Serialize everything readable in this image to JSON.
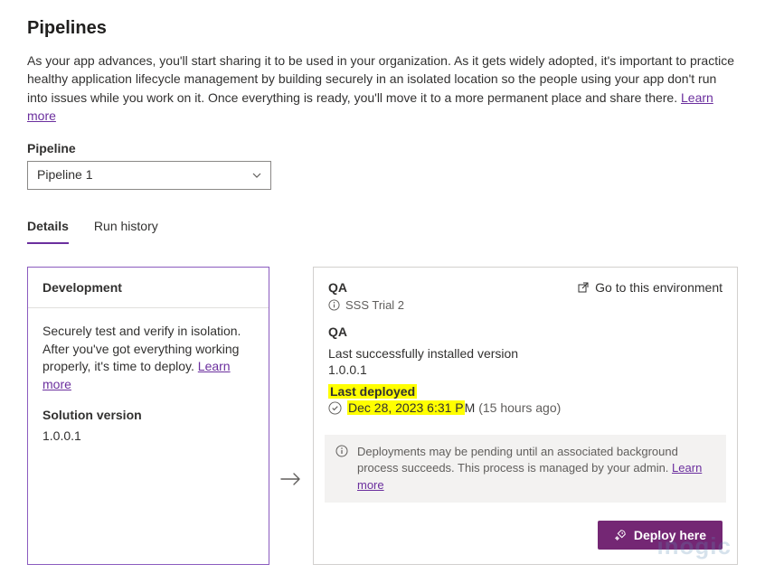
{
  "page": {
    "title": "Pipelines",
    "intro": "As your app advances, you'll start sharing it to be used in your organization. As it gets widely adopted, it's important to practice healthy application lifecycle management by building securely in an isolated location so the people using your app don't run into issues while you work on it. Once everything is ready, you'll move it to a more permanent place and share there. ",
    "learnMore": "Learn more"
  },
  "pipelineField": {
    "label": "Pipeline",
    "selected": "Pipeline 1"
  },
  "tabs": {
    "details": "Details",
    "runHistory": "Run history"
  },
  "devCard": {
    "title": "Development",
    "desc": "Securely test and verify in isolation. After you've got everything working properly, it's time to deploy. ",
    "learnMore": "Learn more",
    "solutionLabel": "Solution version",
    "solutionVersion": "1.0.0.1"
  },
  "qaCard": {
    "topTitle": "QA",
    "envName": "SSS Trial 2",
    "gotoLabel": "Go to this environment",
    "sectionTitle": "QA",
    "installedLabel": "Last successfully installed version",
    "installedVersion": "1.0.0.1",
    "deployedLabel": "Last deployed",
    "deployedDate": "Dec 28, 2023 6:31 P",
    "deployedSuffix": "M ",
    "relative": "(15 hours ago)",
    "banner": "Deployments may be pending until an associated background process succeeds. This process is managed by your admin. ",
    "bannerLearnMore": "Learn more",
    "deployBtn": "Deploy here"
  },
  "watermark": "inogic"
}
